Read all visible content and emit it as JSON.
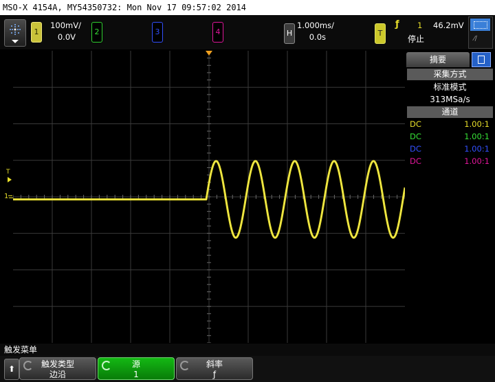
{
  "window": {
    "title": "MSO-X 4154A, MY54350732: Mon Nov 17 09:57:02 2014"
  },
  "channels": [
    {
      "number": "1",
      "scale": "100mV/",
      "offset": "0.0V",
      "color": "#e8df2a"
    },
    {
      "number": "2",
      "scale": "",
      "offset": "",
      "color": "#36e036"
    },
    {
      "number": "3",
      "scale": "",
      "offset": "",
      "color": "#3350ff"
    },
    {
      "number": "4",
      "scale": "",
      "offset": "",
      "color": "#e1169b"
    }
  ],
  "horizontal": {
    "badge": "H",
    "timebase": "1.000ms/",
    "delay": "0.0s"
  },
  "trigger": {
    "badge": "T",
    "slope_glyph": "ƒ",
    "source": "1",
    "level": "46.2mV",
    "status": "停止"
  },
  "side_panel": {
    "tab_label": "摘要",
    "acquisition_header": "采集方式",
    "acquisition_mode": "标准模式",
    "sample_rate": "313MSa/s",
    "channels_header": "通道",
    "coupling": [
      {
        "coupling": "DC",
        "probe": "1.00:1",
        "color": "#e8df2a"
      },
      {
        "coupling": "DC",
        "probe": "1.00:1",
        "color": "#36e036"
      },
      {
        "coupling": "DC",
        "probe": "1.00:1",
        "color": "#3350ff"
      },
      {
        "coupling": "DC",
        "probe": "1.00:1",
        "color": "#e1169b"
      }
    ]
  },
  "markers": {
    "trigger_level": "T",
    "ground_ch1": "1"
  },
  "waveform": {
    "type": "sine",
    "channel": "1",
    "cycles_after_trigger": 5,
    "color": "#e8df2a"
  },
  "softkeys": {
    "menu_title": "触发菜单",
    "back_glyph": "⬆",
    "keys": [
      {
        "label": "触发类型",
        "value": "边沿"
      },
      {
        "label": "源",
        "value": "1"
      },
      {
        "label": "斜率",
        "value": "ƒ"
      }
    ]
  }
}
